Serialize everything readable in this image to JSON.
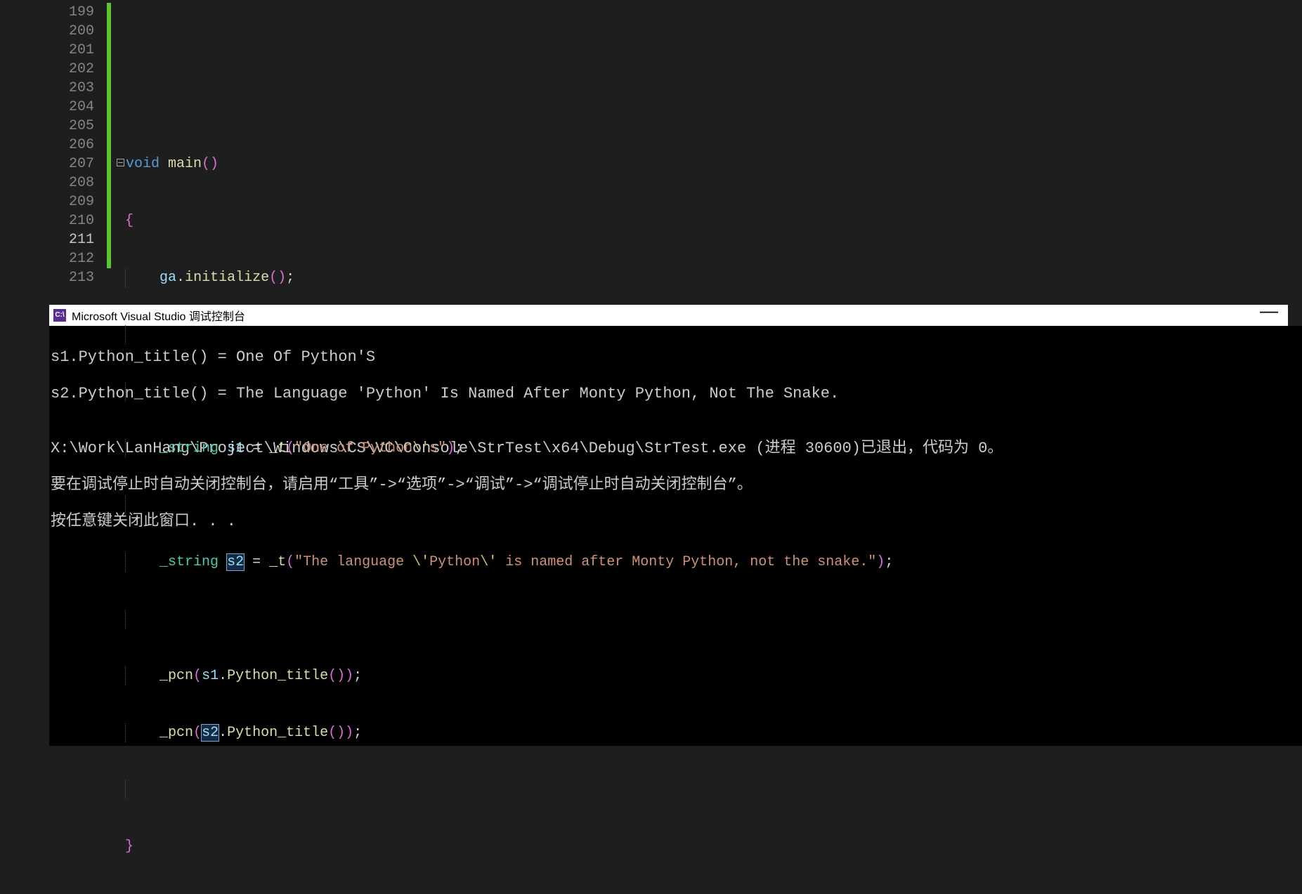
{
  "editor": {
    "current_line": 211,
    "lines": [
      199,
      200,
      201,
      202,
      203,
      204,
      205,
      206,
      207,
      208,
      209,
      210,
      211,
      212,
      213
    ],
    "code": {
      "l201_void": "void",
      "l201_main": "main",
      "l203_obj": "ga",
      "l203_method": "initialize",
      "l206_type": "_string",
      "l206_var": "s1",
      "l206_fn": "_t",
      "l206_str": "\"One of Python",
      "l206_esc": "\\'",
      "l206_str2": "s\"",
      "l208_type": "_string",
      "l208_var": "s2",
      "l208_fn": "_t",
      "l208_str1": "\"The language ",
      "l208_esc1": "\\'",
      "l208_str2": "Python",
      "l208_esc2": "\\'",
      "l208_str3": " is named after Monty Python, not the snake.\"",
      "l210_fn": "_pcn",
      "l210_var": "s1",
      "l210_method": "Python_title",
      "l211_fn": "_pcn",
      "l211_var": "s2",
      "l211_method": "Python_title"
    }
  },
  "console": {
    "title": "Microsoft Visual Studio 调试控制台",
    "out1": "s1.Python_title() = One Of Python'S",
    "out2": "s2.Python_title() = The Language 'Python' Is Named After Monty Python, Not The Snake.",
    "blank": "",
    "exit": "X:\\Work\\LanHang\\Project\\Windows\\CS\\VC\\Console\\StrTest\\x64\\Debug\\StrTest.exe (进程 30600)已退出，代码为 0。",
    "hint": "要在调试停止时自动关闭控制台，请启用“工具”->“选项”->“调试”->“调试停止时自动关闭控制台”。",
    "anykey": "按任意键关闭此窗口. . ."
  }
}
